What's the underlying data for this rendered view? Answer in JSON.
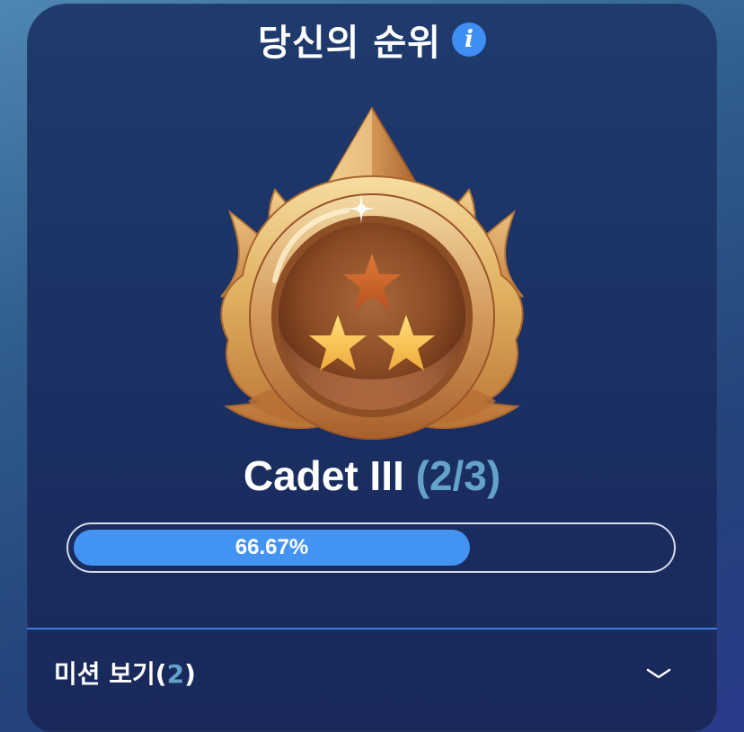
{
  "header": {
    "title": "당신의 순위",
    "info_icon": "info-icon",
    "info_glyph": "i"
  },
  "rank": {
    "name": "Cadet III",
    "progress_label": "(2/3)",
    "stars_earned": 2,
    "stars_total": 3,
    "medal_icon": "bronze-medal-icon"
  },
  "progress": {
    "percent_text": "66.67%",
    "fraction": 0.6667
  },
  "missions": {
    "prefix": "미션 보기(",
    "count": "2",
    "suffix": ")",
    "chevron_icon": "chevron-down-icon"
  },
  "colors": {
    "accent_blue": "#4394f2",
    "count_blue": "#63a3c9",
    "card_bg": "#1f3b6d",
    "divider": "#3b7fe0"
  }
}
